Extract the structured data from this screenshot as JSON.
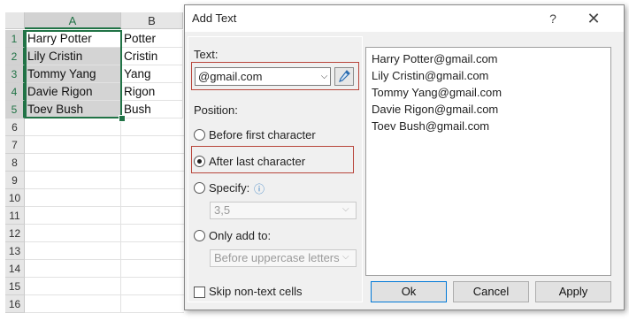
{
  "sheet": {
    "columns": [
      "A",
      "B"
    ],
    "rows": [
      "1",
      "2",
      "3",
      "4",
      "5",
      "6",
      "7",
      "8",
      "9",
      "10",
      "11",
      "12",
      "13",
      "14",
      "15",
      "16"
    ],
    "col_a": [
      "Harry Potter",
      "Lily Cristin",
      "Tommy Yang",
      "Davie Rigon",
      "Toev Bush"
    ],
    "col_b": [
      "Potter",
      "Cristin",
      "Yang",
      "Rigon",
      "Bush"
    ],
    "selection_color": "#217346"
  },
  "dialog": {
    "title": "Add Text",
    "help_label": "?",
    "close_label": "✕",
    "text_label": "Text:",
    "text_value": "@gmail.com",
    "dropdown_glyph": "⌵",
    "position_label": "Position:",
    "options": {
      "before_first": "Before first character",
      "after_last": "After last character",
      "specify": "Specify:",
      "only_add_to": "Only add to:"
    },
    "selected_option": "after_last",
    "specify_value": "3,5",
    "only_add_to_value": "Before uppercase letters",
    "skip_label": "Skip non-text cells",
    "skip_checked": false,
    "info_icon": "ⓘ",
    "preview": [
      "Harry Potter@gmail.com",
      "Lily Cristin@gmail.com",
      "Tommy Yang@gmail.com",
      "Davie Rigon@gmail.com",
      "Toev Bush@gmail.com"
    ],
    "buttons": {
      "ok": "Ok",
      "cancel": "Cancel",
      "apply": "Apply"
    },
    "highlight_color": "#b8453b",
    "default_button_color": "#0078d7"
  }
}
